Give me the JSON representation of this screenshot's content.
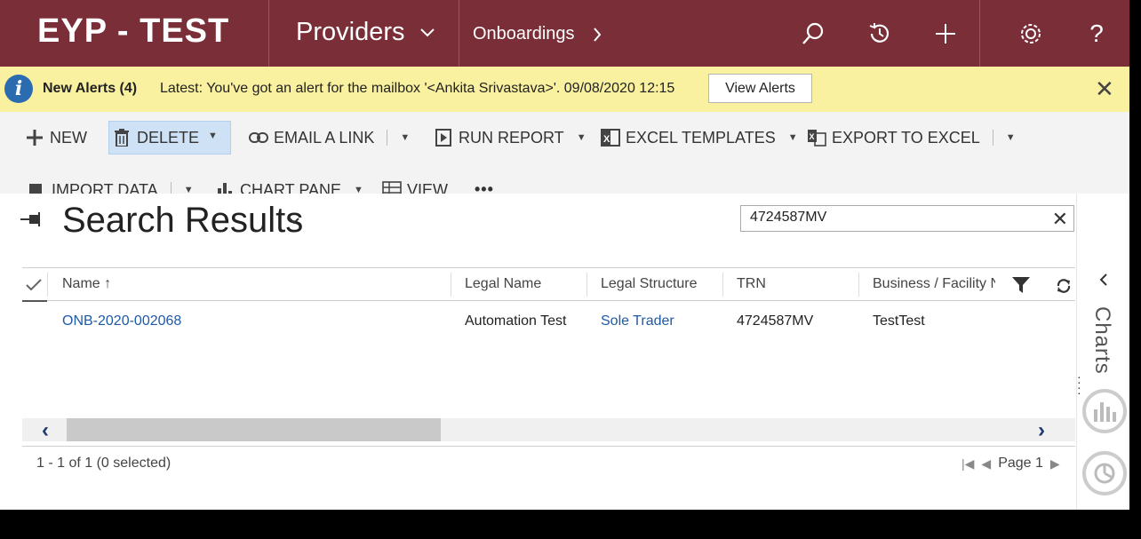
{
  "header": {
    "brand": "EYP - TEST",
    "area": "Providers",
    "entity": "Onboardings"
  },
  "alert": {
    "title": "New Alerts (4)",
    "message": "Latest: You've got an alert for the mailbox '<Ankita Srivastava>'. 09/08/2020 12:15",
    "button_label": "View Alerts"
  },
  "commands": {
    "new": "NEW",
    "delete": "DELETE",
    "email_link": "EMAIL A LINK",
    "run_report": "RUN REPORT",
    "excel_templates": "EXCEL TEMPLATES",
    "export_excel": "EXPORT TO EXCEL",
    "import_data": "IMPORT DATA",
    "chart_pane": "CHART PANE",
    "view": "VIEW",
    "more": "•••"
  },
  "view": {
    "title": "Search Results"
  },
  "search": {
    "value": "4724587MV"
  },
  "grid": {
    "columns": [
      "Name ↑",
      "Legal Name",
      "Legal Structure",
      "TRN",
      "Business / Facility N"
    ],
    "rows": [
      {
        "name": "ONB-2020-002068",
        "legal_name": "Automation Test",
        "legal_structure": "Sole Trader",
        "trn": "4724587MV",
        "business": "TestTest"
      }
    ],
    "footer_count": "1 - 1 of 1 (0 selected)",
    "page_label": "Page 1"
  },
  "rail": {
    "label": "Charts"
  },
  "colors": {
    "header_bg": "#7a2f38",
    "alert_bg": "#f9f0a0",
    "link": "#1f5aa6"
  }
}
